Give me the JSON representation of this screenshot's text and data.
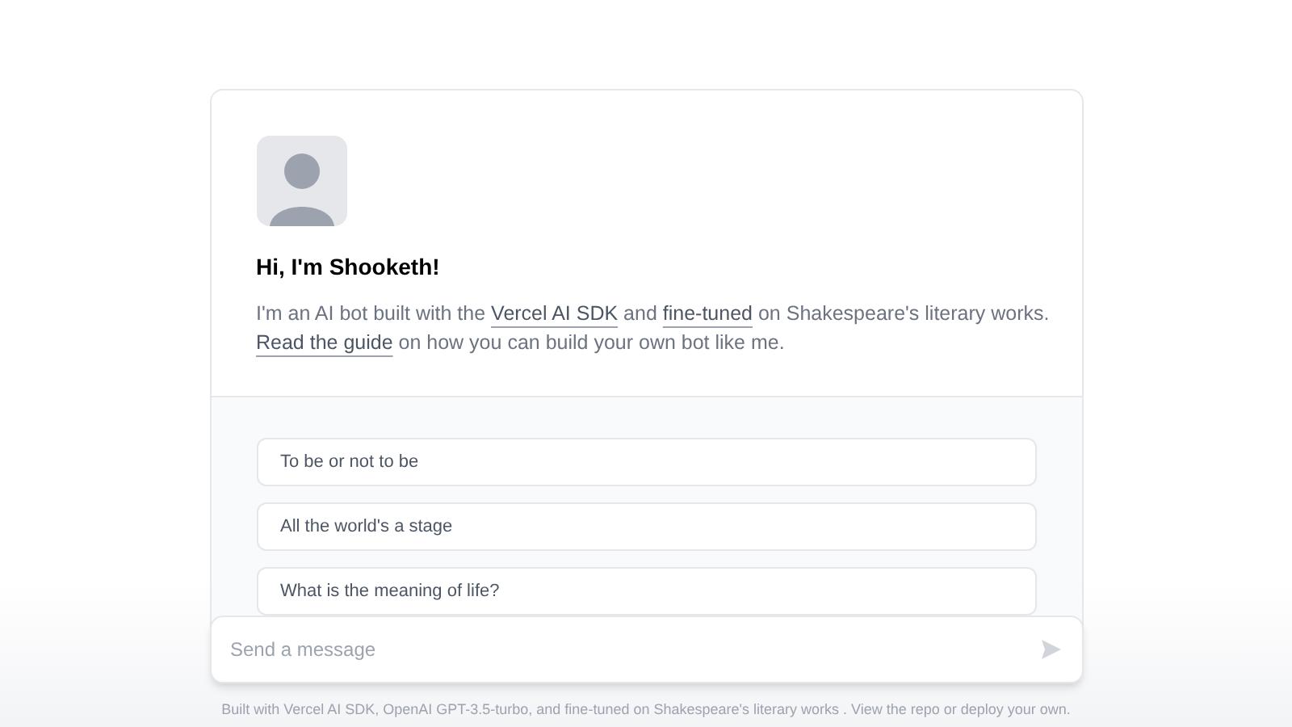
{
  "intro": {
    "title": "Hi, I'm Shooketh!",
    "lines": [
      [
        {
          "kind": "text",
          "text": "I'm an AI bot built with the"
        },
        {
          "kind": "link",
          "text": "Vercel AI SDK"
        },
        {
          "kind": "text",
          "text": "and"
        },
        {
          "kind": "link",
          "text": "fine-tuned"
        },
        {
          "kind": "text",
          "text": "on Shakespeare's literary works."
        }
      ],
      [
        {
          "kind": "link",
          "text": "Read the guide"
        },
        {
          "kind": "text",
          "text": "on how you can build your own bot like me."
        }
      ]
    ]
  },
  "examples": [
    "To be or not to be",
    "All the world's a stage",
    "What is the meaning of life?"
  ],
  "composer": {
    "placeholder": "Send a message"
  },
  "footer": "Built with Vercel AI SDK, OpenAI GPT-3.5-turbo, and fine-tuned on Shakespeare's literary works . View the repo or deploy your own."
}
